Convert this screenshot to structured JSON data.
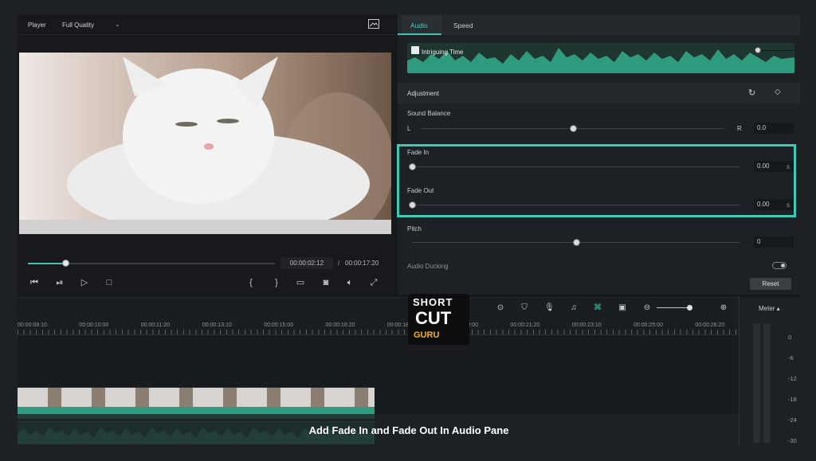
{
  "player": {
    "title": "Player",
    "quality": "Full Quality",
    "current_time": "00:00:02:12",
    "separator": "/",
    "total_time": "00:00:17:20",
    "progress": 0.15
  },
  "tabs": [
    {
      "label": "Audio",
      "active": true
    },
    {
      "label": "Speed",
      "active": false
    }
  ],
  "audio": {
    "clip_name": "Intriguing Time",
    "adjustment_title": "Adjustment",
    "sound_balance": {
      "label": "Sound Balance",
      "left": "L",
      "right": "R",
      "value": "0.0",
      "level": 0.5
    },
    "fade_in": {
      "label": "Fade In",
      "value": "0.00",
      "unit": "s",
      "level": 0
    },
    "fade_out": {
      "label": "Fade Out",
      "value": "0.00",
      "unit": "s",
      "level": 0
    },
    "pitch": {
      "label": "Pitch",
      "value": "0",
      "level": 0.5
    },
    "audio_ducking": "Audio Ducking",
    "reset_label": "Reset"
  },
  "timeline": {
    "ruler_labels": [
      "00:00:08:10",
      "00:00:10:00",
      "00:00:11:20",
      "00:00:13:10",
      "00:00:15:00",
      "00:00:16:20",
      "00:00:18:10",
      "00:00:20:00",
      "00:00:21:20",
      "00:00:23:10",
      "00:00:25:00",
      "00:00:26:20"
    ]
  },
  "meter": {
    "title": "Meter ▴",
    "ticks": [
      "0",
      "-6",
      "-12",
      "-18",
      "-24",
      "-30"
    ]
  },
  "caption": "Add Fade In and Fade Out In Audio Pane",
  "logo": {
    "line1": "SHORT",
    "line2": "CUT",
    "line3": "GURU"
  },
  "colors": {
    "accent": "#41c1b0",
    "highlight": "#3fcab3"
  }
}
